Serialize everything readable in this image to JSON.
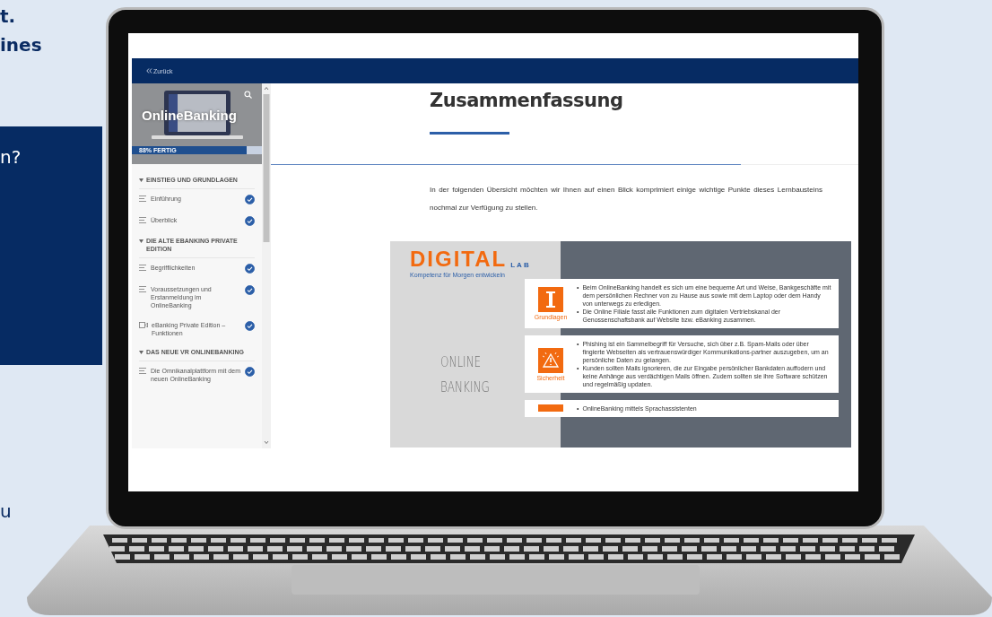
{
  "backdrop": {
    "heading_lines": [
      "t.",
      "ines"
    ],
    "box_text": "n?",
    "bottom_text": "u"
  },
  "course": {
    "back_label": "Zurück",
    "title": "OnlineBanking",
    "progress_label": "88% FERTIG",
    "progress": {
      "level": 0.88
    },
    "sections": [
      {
        "title": "EINSTIEG UND GRUNDLAGEN",
        "expanded": true,
        "items": [
          {
            "label": "Einführung",
            "kind": "text",
            "completed": true
          },
          {
            "label": "Überblick",
            "kind": "text",
            "completed": true
          }
        ]
      },
      {
        "title": "DIE ALTE EBANKING PRIVATE EDITION",
        "expanded": true,
        "items": [
          {
            "label": "Begrifflichkeiten",
            "kind": "text",
            "completed": true
          },
          {
            "label": "Voraussetzungen und Erstanmeldung im OnlineBanking",
            "kind": "text",
            "completed": true
          },
          {
            "label": "eBanking Private Edition – Funktionen",
            "kind": "video",
            "completed": true
          }
        ]
      },
      {
        "title": "DAS NEUE VR ONLINEBANKING",
        "expanded": true,
        "items": [
          {
            "label": "Die Omnikanalplattform mit dem neuen OnlineBanking",
            "kind": "text",
            "completed": true
          }
        ]
      }
    ]
  },
  "lesson": {
    "title": "Zusammenfassung",
    "scroll_progress": {
      "level": 0.8
    },
    "intro": "In der folgenden Übersicht möchten wir Ihnen auf einen Blick komprimiert einige wichtige Punkte dieses Lernbausteins nochmal zur Verfügung zu stellen.",
    "infographic": {
      "bullet_marker": "•",
      "logo_word": "DIGITAL",
      "logo_sub": "LAB",
      "tagline": "Kompetenz für Morgen entwickeln",
      "headline_lines": [
        "ONLINE",
        "BANKING"
      ],
      "cards": [
        {
          "kind": "pillar",
          "label": "Grundlagen",
          "bullets": [
            "Beim OnlineBanking handelt es sich um eine bequeme Art und Weise, Bankgeschäfte mit dem persönlichen Rechner von zu Hause aus sowie mit dem Laptop oder dem Handy von unterwegs zu erledigen.",
            "Die Online Filiale fasst alle Funktionen zum digitalen Vertriebskanal der Genossenschaftsbank auf Website bzw. eBanking zusammen."
          ]
        },
        {
          "kind": "warning",
          "label": "Sicherheit",
          "bullets": [
            "Phishing ist ein Sammelbegriff für Versuche, sich über z.B. Spam-Mails oder über fingierte Webseiten als vertrauenswürdiger Kommunikations-partner auszugeben, um an persönliche Daten zu gelangen.",
            "Kunden sollten Mails ignorieren, die zur Eingabe persönlicher Bankdaten auffodern und keine Anhänge aus verdächtigen Mails öffnen. Zudem sollten sie ihre Software schützen und regelmäßig updaten."
          ]
        },
        {
          "kind": "blank",
          "bullets": [
            "OnlineBanking mittels Sprachassistenten"
          ]
        }
      ]
    }
  }
}
